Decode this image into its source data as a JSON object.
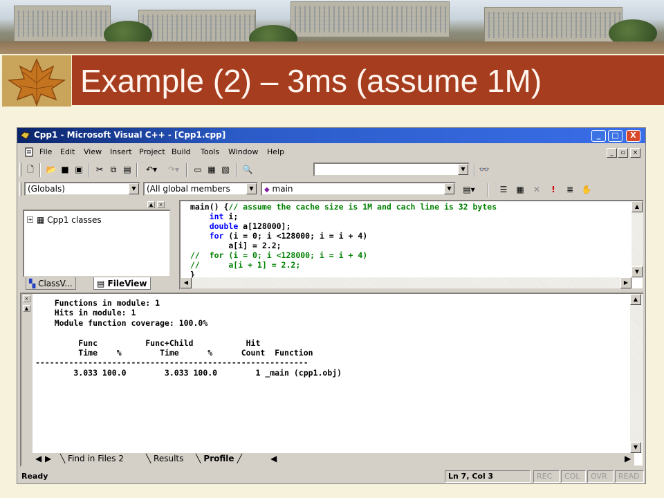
{
  "slide": {
    "title": "Example (2) – 3ms (assume 1M)"
  },
  "window": {
    "title": "Cpp1 - Microsoft Visual C++ - [Cpp1.cpp]",
    "caption_buttons": [
      "_",
      "□",
      "X"
    ]
  },
  "menu": [
    "File",
    "Edit",
    "View",
    "Insert",
    "Project",
    "Build",
    "Tools",
    "Window",
    "Help"
  ],
  "toolbar2": {
    "scope_combo": "(Globals)",
    "members_combo": "(All global members",
    "function_combo": "main"
  },
  "workspace": {
    "tree_root": "Cpp1 classes",
    "tabs": [
      "ClassV...",
      "FileView"
    ]
  },
  "editor": {
    "lines": [
      {
        "parts": [
          {
            "t": "main() {",
            "c": "pl"
          },
          {
            "t": "// assume the cache size is 1M and cach line is 32 bytes",
            "c": "cm"
          }
        ]
      },
      {
        "parts": [
          {
            "t": "    ",
            "c": "pl"
          },
          {
            "t": "int",
            "c": "kw"
          },
          {
            "t": " i;",
            "c": "pl"
          }
        ]
      },
      {
        "parts": [
          {
            "t": "    ",
            "c": "pl"
          },
          {
            "t": "double",
            "c": "kw"
          },
          {
            "t": " a[128000];",
            "c": "pl"
          }
        ]
      },
      {
        "parts": [
          {
            "t": "    ",
            "c": "pl"
          },
          {
            "t": "for",
            "c": "kw"
          },
          {
            "t": " (i = 0; i <128000; i = i + 4)",
            "c": "pl"
          }
        ]
      },
      {
        "parts": [
          {
            "t": "        a[i] = 2.2;",
            "c": "pl"
          }
        ]
      },
      {
        "parts": [
          {
            "t": "//  for (i = 0; i <128000; i = i + 4)",
            "c": "cm"
          }
        ]
      },
      {
        "parts": [
          {
            "t": "//      a[i + 1] = 2.2;",
            "c": "cm"
          }
        ]
      },
      {
        "parts": [
          {
            "t": "}",
            "c": "pl"
          }
        ]
      }
    ]
  },
  "output": {
    "lines": [
      "    Functions in module: 1",
      "    Hits in module: 1",
      "    Module function coverage: 100.0%",
      "",
      "         Func          Func+Child           Hit",
      "         Time    %        Time      %      Count  Function",
      "---------------------------------------------------------",
      "        3.033 100.0        3.033 100.0        1 _main (cpp1.obj)"
    ],
    "tabs": [
      "Find in Files 2",
      "Results",
      "Profile"
    ]
  },
  "status": {
    "ready": "Ready",
    "position": "Ln 7, Col 3",
    "indicators": [
      "REC",
      "COL",
      "OVR",
      "READ"
    ]
  }
}
